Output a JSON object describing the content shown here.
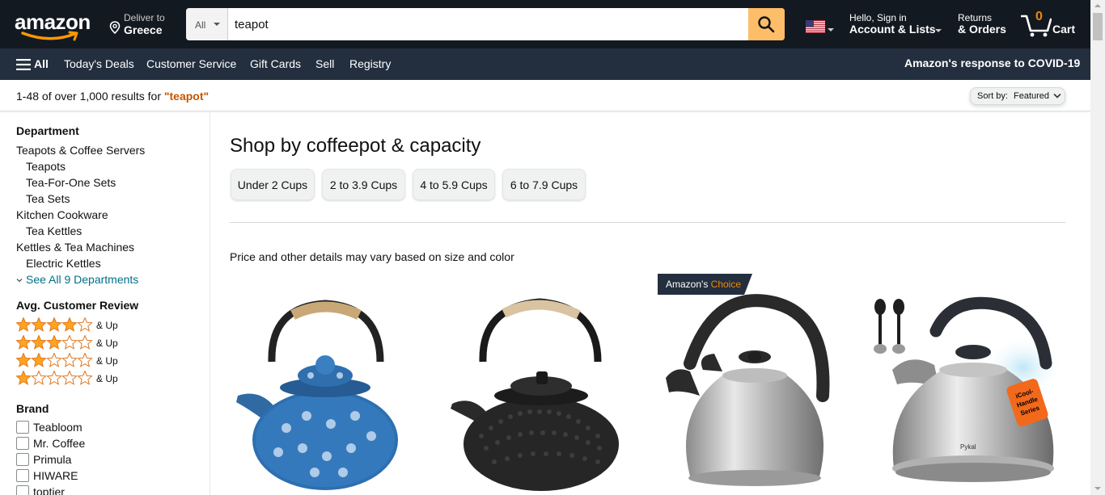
{
  "header": {
    "logo_text": "amazon",
    "deliver_line1": "Deliver to",
    "deliver_line2": "Greece",
    "search": {
      "category": "All",
      "value": "teapot",
      "placeholder": ""
    },
    "account_line1": "Hello, Sign in",
    "account_line2": "Account & Lists",
    "returns_line1": "Returns",
    "returns_line2": "& Orders",
    "cart_count": "0",
    "cart_label": "Cart"
  },
  "subnav": {
    "all_label": "All",
    "items": [
      "Today's Deals",
      "Customer Service",
      "Gift Cards",
      "Sell",
      "Registry"
    ],
    "covid": "Amazon's response to COVID-19"
  },
  "results": {
    "prefix": "1-48 of over 1,000 results for ",
    "query": "\"teapot\"",
    "sort_label": "Sort by:",
    "sort_value": "Featured"
  },
  "sidebar": {
    "department_heading": "Department",
    "departments": [
      {
        "label": "Teapots & Coffee Servers",
        "level": 0
      },
      {
        "label": "Teapots",
        "level": 1
      },
      {
        "label": "Tea-For-One Sets",
        "level": 1
      },
      {
        "label": "Tea Sets",
        "level": 1
      },
      {
        "label": "Kitchen Cookware",
        "level": 0
      },
      {
        "label": "Tea Kettles",
        "level": 1
      },
      {
        "label": "Kettles & Tea Machines",
        "level": 0
      },
      {
        "label": "Electric Kettles",
        "level": 1
      }
    ],
    "see_all": "See All 9 Departments",
    "review_heading": "Avg. Customer Review",
    "reviews": [
      {
        "stars": 4,
        "label": "& Up"
      },
      {
        "stars": 3,
        "label": "& Up"
      },
      {
        "stars": 2,
        "label": "& Up"
      },
      {
        "stars": 1,
        "label": "& Up"
      }
    ],
    "brand_heading": "Brand",
    "brands": [
      "Teabloom",
      "Mr. Coffee",
      "Primula",
      "HIWARE",
      "toptier"
    ]
  },
  "main": {
    "title": "Shop by coffeepot & capacity",
    "capacity_pills": [
      "Under 2 Cups",
      "2 to 3.9 Cups",
      "4 to 5.9 Cups",
      "6 to 7.9 Cups"
    ],
    "price_note": "Price and other details may vary based on size and color",
    "badge_prefix": "Amazon's",
    "badge_choice": "Choice",
    "product_side_label": "iCool-Handle Series",
    "product_brand_mark": "Pykal"
  },
  "colors": {
    "nav_top": "#131921",
    "nav_sub": "#232f3e",
    "search_button": "#febd69",
    "query_color": "#c45500",
    "link_teal": "#007185",
    "star": "#ffa41c",
    "badge_bg": "#232f3e",
    "cart_count": "#f08804"
  }
}
